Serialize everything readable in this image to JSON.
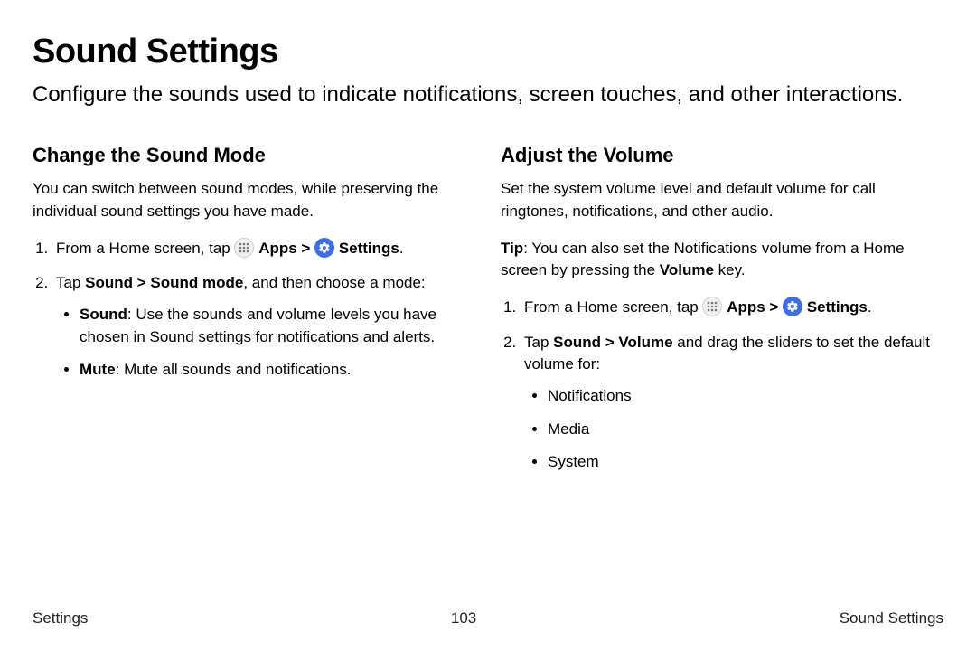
{
  "page": {
    "title": "Sound Settings",
    "intro": "Configure the sounds used to indicate notifications, screen touches, and other interactions."
  },
  "left": {
    "heading": "Change the Sound Mode",
    "intro": "You can switch between sound modes, while preserving the individual sound settings you have made.",
    "step1_prefix": "From a Home screen, tap ",
    "apps_label": "Apps",
    "chevron": " > ",
    "settings_label": "Settings",
    "step1_suffix": ".",
    "step2_prefix": "Tap ",
    "step2_bold": "Sound > Sound mode",
    "step2_suffix": ", and then choose a mode:",
    "bullet1_bold": "Sound",
    "bullet1_rest": ": Use the sounds and volume levels you have chosen in Sound settings for notifications and alerts.",
    "bullet2_bold": "Mute",
    "bullet2_rest": ": Mute all sounds and notifications."
  },
  "right": {
    "heading": "Adjust the Volume",
    "intro": "Set the system volume level and default volume for call ringtones, notifications, and other audio.",
    "tip_bold": "Tip",
    "tip_mid": ": You can also set the Notifications volume from a Home screen by pressing the ",
    "tip_volume": "Volume",
    "tip_suffix": " key.",
    "step1_prefix": "From a Home screen, tap ",
    "apps_label": "Apps",
    "chevron": " > ",
    "settings_label": "Settings",
    "step1_suffix": ".",
    "step2_prefix": "Tap ",
    "step2_bold": "Sound > Volume",
    "step2_suffix": " and drag the sliders to set the default volume for:",
    "bullets": {
      "0": "Notifications",
      "1": "Media",
      "2": "System"
    }
  },
  "footer": {
    "left": "Settings",
    "center": "103",
    "right": "Sound Settings"
  }
}
